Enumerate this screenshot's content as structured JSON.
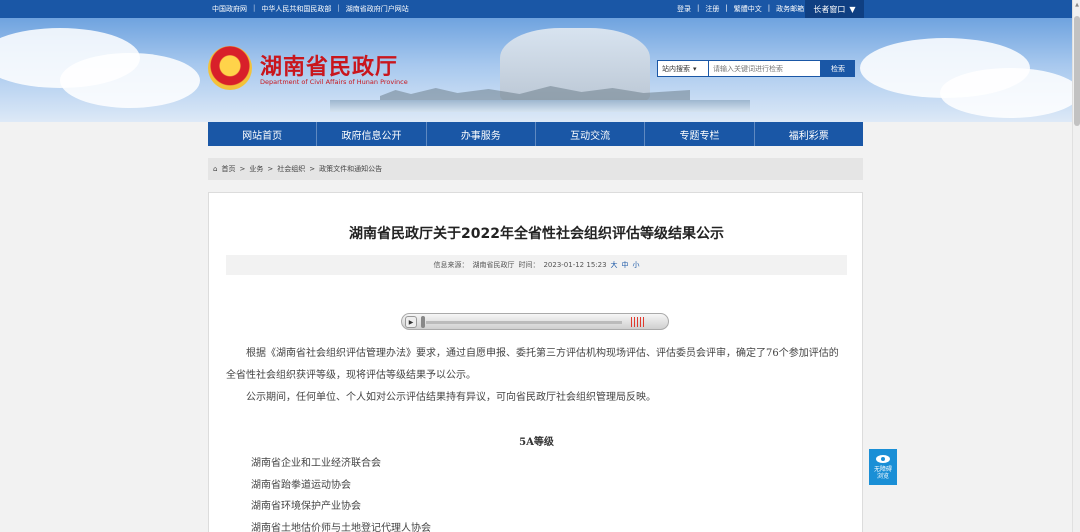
{
  "topbar": {
    "links": [
      "中国政府网",
      "中华人民共和国民政部",
      "湖南省政府门户网站"
    ],
    "right_links": [
      "登录",
      "注册",
      "繁體中文",
      "政务邮箱"
    ],
    "elder_mode": "长者窗口"
  },
  "header": {
    "title": "湖南省民政厅",
    "subtitle": "Department of Civil Affairs of Hunan Province"
  },
  "search": {
    "scope": "站内搜索",
    "placeholder": "请输入关键词进行检索",
    "button": "检索"
  },
  "nav": [
    "网站首页",
    "政府信息公开",
    "办事服务",
    "互动交流",
    "专题专栏",
    "福利彩票"
  ],
  "breadcrumb": [
    "首页",
    "业务",
    "社会组织",
    "政策文件和通知公告"
  ],
  "article": {
    "title": "湖南省民政厅关于2022年全省性社会组织评估等级结果公示",
    "source_label": "信息来源：",
    "source": "湖南省民政厅",
    "time_label": "时间：",
    "time": "2023-01-12 15:23",
    "font_sizes": [
      "大",
      "中",
      "小"
    ],
    "paragraphs": [
      "根据《湖南省社会组织评估管理办法》要求，通过自愿申报、委托第三方评估机构现场评估、评估委员会评审，确定了76个参加评估的全省性社会组织获评等级，现将评估等级结果予以公示。",
      "公示期间，任何单位、个人如对公示评估结果持有异议，可向省民政厅社会组织管理局反映。"
    ],
    "grade_heading": "5A等级",
    "organizations": [
      "湖南省企业和工业经济联合会",
      "湖南省跆拳道运动协会",
      "湖南省环境保护产业协会",
      "湖南省土地估价师与土地登记代理人协会"
    ]
  },
  "accessibility": {
    "line1": "无障碍",
    "line2": "浏览"
  }
}
